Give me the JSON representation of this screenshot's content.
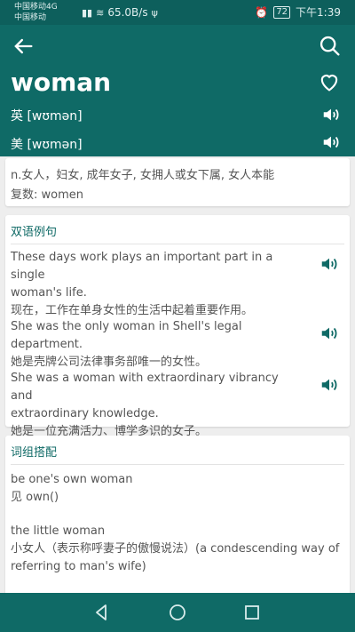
{
  "statusbar": {
    "carrier1": "中国移动4G",
    "carrier2": "中国移动",
    "speed": "65.0B/s",
    "battery": "72",
    "time": "下午1:39"
  },
  "header": {
    "word": "woman",
    "uk_label": "英 [wʊmən]",
    "us_label": "美 [wʊmən]"
  },
  "definition": {
    "line1": "n.女人，妇女, 成年女子, 女拥人或女下属, 女人本能",
    "line2": "复数: women"
  },
  "examples": {
    "title": "双语例句",
    "items": [
      {
        "en1": "These days work plays an important part in a single",
        "en2": "woman's life.",
        "zh": "现在，工作在单身女性的生活中起着重要作用。"
      },
      {
        "en1": "She was the only woman in Shell's legal department.",
        "en2": "",
        "zh": "她是壳牌公司法律事务部唯一的女性。"
      },
      {
        "en1": "She was a woman with extraordinary vibrancy and",
        "en2": "extraordinary knowledge.",
        "zh": "她是一位充满活力、博学多识的女子。"
      }
    ]
  },
  "phrases": {
    "title": "词组搭配",
    "items": [
      {
        "en": "be one's own woman",
        "zh": "见 own()"
      },
      {
        "en": "the little woman",
        "zh": "小女人（表示称呼妻子的傲慢说法）(a condescending way of",
        "zh2": "referring to man's wife)"
      }
    ]
  },
  "icons": {
    "back": "back-arrow-icon",
    "search": "search-icon",
    "favorite": "heart-icon",
    "speaker": "speaker-icon"
  },
  "colors": {
    "primary": "#0f6a66",
    "statusbar": "#0d5f5c",
    "accent_text": "#0f6a66"
  }
}
